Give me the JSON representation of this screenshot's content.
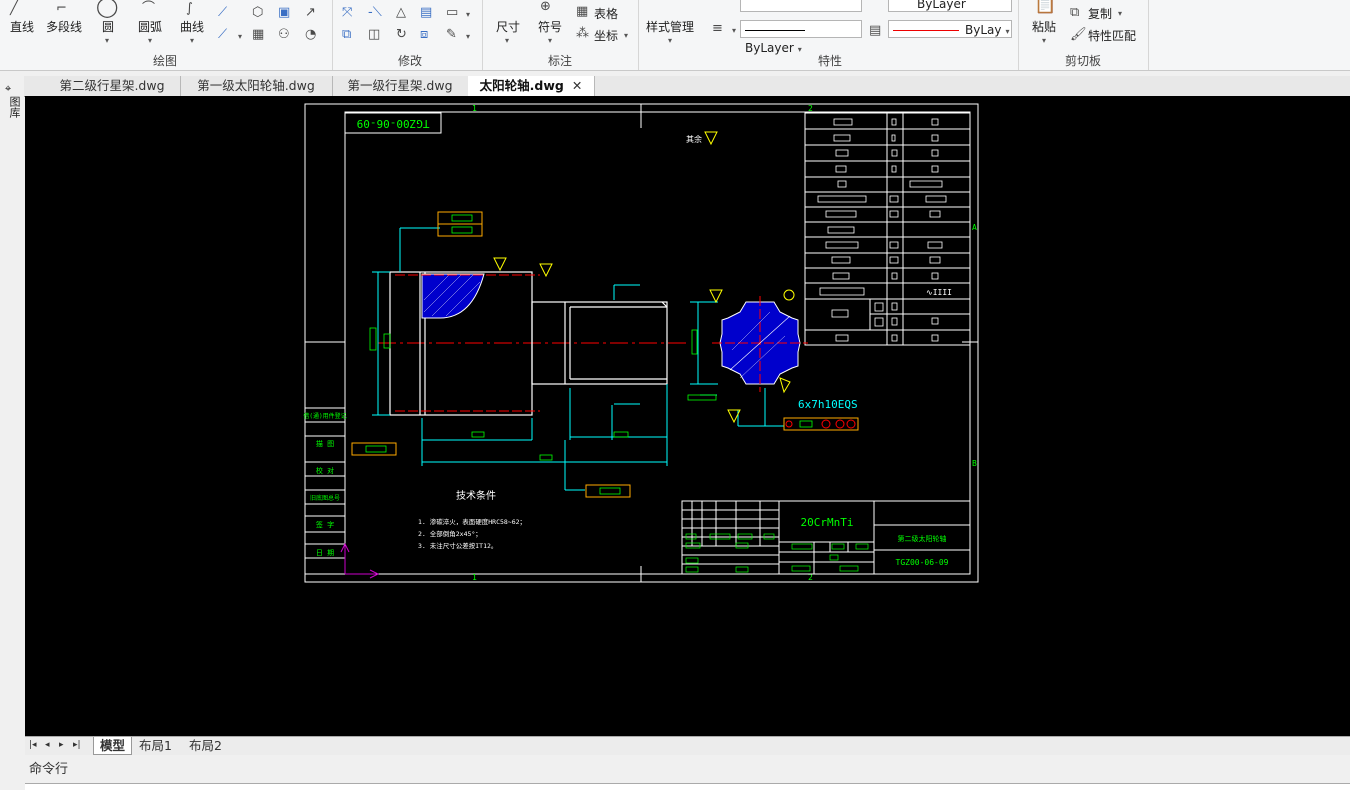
{
  "ribbon": {
    "draw": {
      "line": "直线",
      "polyline": "多段线",
      "circle": "圆",
      "arc": "圆弧",
      "curve": "曲线",
      "group": "绘图"
    },
    "modify": {
      "group": "修改"
    },
    "annotate": {
      "dimension": "尺寸",
      "symbol": "符号",
      "table": "表格",
      "coord": "坐标",
      "group": "标注"
    },
    "properties": {
      "style_mgr": "样式管理",
      "layer_combo": "ByLayer",
      "linetype_combo": "ByLayer",
      "color_combo": "ByLayer",
      "lineweight_combo": "ByLay",
      "group": "特性"
    },
    "clipboard": {
      "paste": "粘贴",
      "copy": "复制",
      "match": "特性匹配",
      "group": "剪切板"
    }
  },
  "file_tabs": [
    {
      "label": "第二级行星架.dwg"
    },
    {
      "label": "第一级太阳轮轴.dwg"
    },
    {
      "label": "第一级行星架.dwg"
    },
    {
      "label": "太阳轮轴.dwg",
      "active": true
    }
  ],
  "left_panel": {
    "label": "图库"
  },
  "drawing": {
    "drawing_number": "TGZ00-06-09",
    "material": "20CrMnTi",
    "part_name": "第二级太阳轮轴",
    "title_number": "TGZ00-06-09",
    "spline_spec": "6x7h10EQS",
    "tech_title": "技术条件",
    "tech_notes": [
      "1. 渗碳淬火，表面硬度HRC58~62；",
      "2. 全部倒角2x45°；",
      "3. 未注尺寸公差按IT12。"
    ],
    "side_labels": [
      "借(通)用件登记",
      "描    图",
      "校    对",
      "旧底图总号",
      "签    字",
      "日    期"
    ],
    "zone_marks": {
      "top_a": "1",
      "top_b": "2",
      "right_a": "A",
      "right_b": "B"
    },
    "roughness_label": "其余"
  },
  "layout_tabs": [
    "模型",
    "布局1",
    "布局2"
  ],
  "command": {
    "label": "命令行"
  },
  "colors": {
    "viewport_bg": "#000000",
    "line_white": "#ffffff",
    "dim_cyan": "#00ffff",
    "center_red": "#ff0000",
    "text_green": "#00ff00",
    "hatch_blue": "#0000ff",
    "tol_yellow": "#ffff00",
    "ucs_magenta": "#cc00cc"
  }
}
